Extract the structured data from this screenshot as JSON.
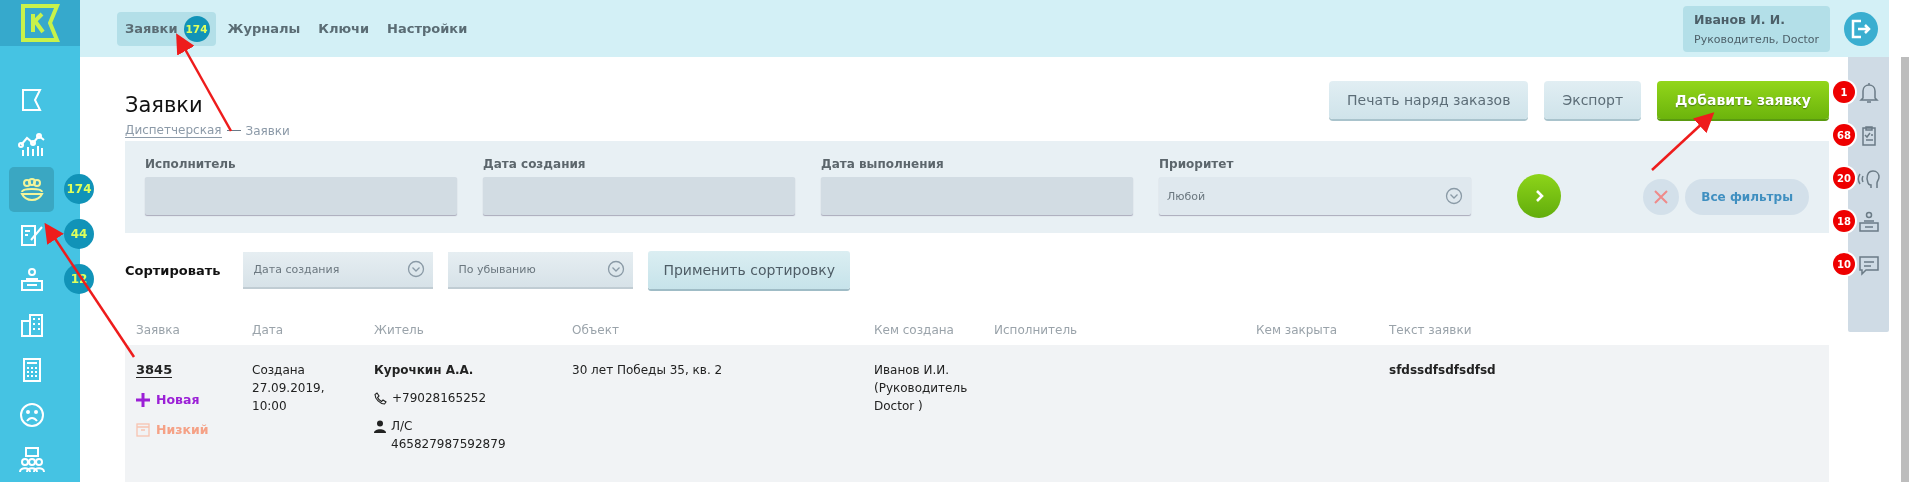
{
  "topnav": {
    "tabs": [
      {
        "label": "Заявки",
        "selected": true,
        "badge": "174"
      },
      {
        "label": "Журналы",
        "selected": false
      },
      {
        "label": "Ключи",
        "selected": false
      },
      {
        "label": "Настройки",
        "selected": false
      }
    ]
  },
  "user": {
    "name": "Иванов И. И.",
    "role": "Руководитель, Doctor"
  },
  "sidebar": {
    "items": [
      {
        "selected": false
      },
      {
        "selected": false
      },
      {
        "selected": true,
        "badge": "174"
      },
      {
        "selected": false,
        "badge": "44"
      },
      {
        "selected": false,
        "badge": "12"
      },
      {
        "selected": false
      },
      {
        "selected": false
      },
      {
        "selected": false
      },
      {
        "selected": false
      }
    ]
  },
  "page": {
    "title": "Заявки",
    "breadcrumbs": [
      {
        "label": "Диспетчерская",
        "link": true
      },
      {
        "label": "Заявки",
        "link": false
      }
    ]
  },
  "actions": [
    {
      "label": "Печать наряд заказов",
      "kind": "secondary"
    },
    {
      "label": "Экспорт",
      "kind": "secondary"
    },
    {
      "label": "Добавить заявку",
      "kind": "primary"
    }
  ],
  "notifications": [
    {
      "count": "1"
    },
    {
      "count": "68"
    },
    {
      "count": "20"
    },
    {
      "count": "18"
    },
    {
      "count": "10"
    }
  ],
  "filters": {
    "fields": [
      {
        "label": "Исполнитель",
        "kind": "text"
      },
      {
        "label": "Дата создания",
        "kind": "text"
      },
      {
        "label": "Дата выполнения",
        "kind": "text"
      },
      {
        "label": "Приоритет",
        "kind": "select",
        "value": "Любой"
      }
    ],
    "all_filters": "Все фильтры"
  },
  "sort": {
    "label": "Сортировать",
    "field": "Дата создания",
    "order": "По убыванию",
    "apply": "Применить сортировку"
  },
  "table": {
    "columns": [
      "Заявка",
      "Дата",
      "Житель",
      "Объект",
      "Кем создана",
      "Исполнитель",
      "Кем закрыта",
      "Текст заявки"
    ],
    "rows": [
      {
        "number": "3845",
        "status": "Новая",
        "priority": "Низкий",
        "date": "Создана 27.09.2019, 10:00",
        "resident": "Курочкин А.А.",
        "phone": "+79028165252",
        "account": "Л/С 465827987592879",
        "object": "30 лет Победы 35, кв. 2",
        "created_by": "Иванов И.И. (Руководитель Doctor )",
        "executor": "",
        "closed_by": "",
        "text": "sfdssdfsdfsdfsd"
      }
    ]
  }
}
